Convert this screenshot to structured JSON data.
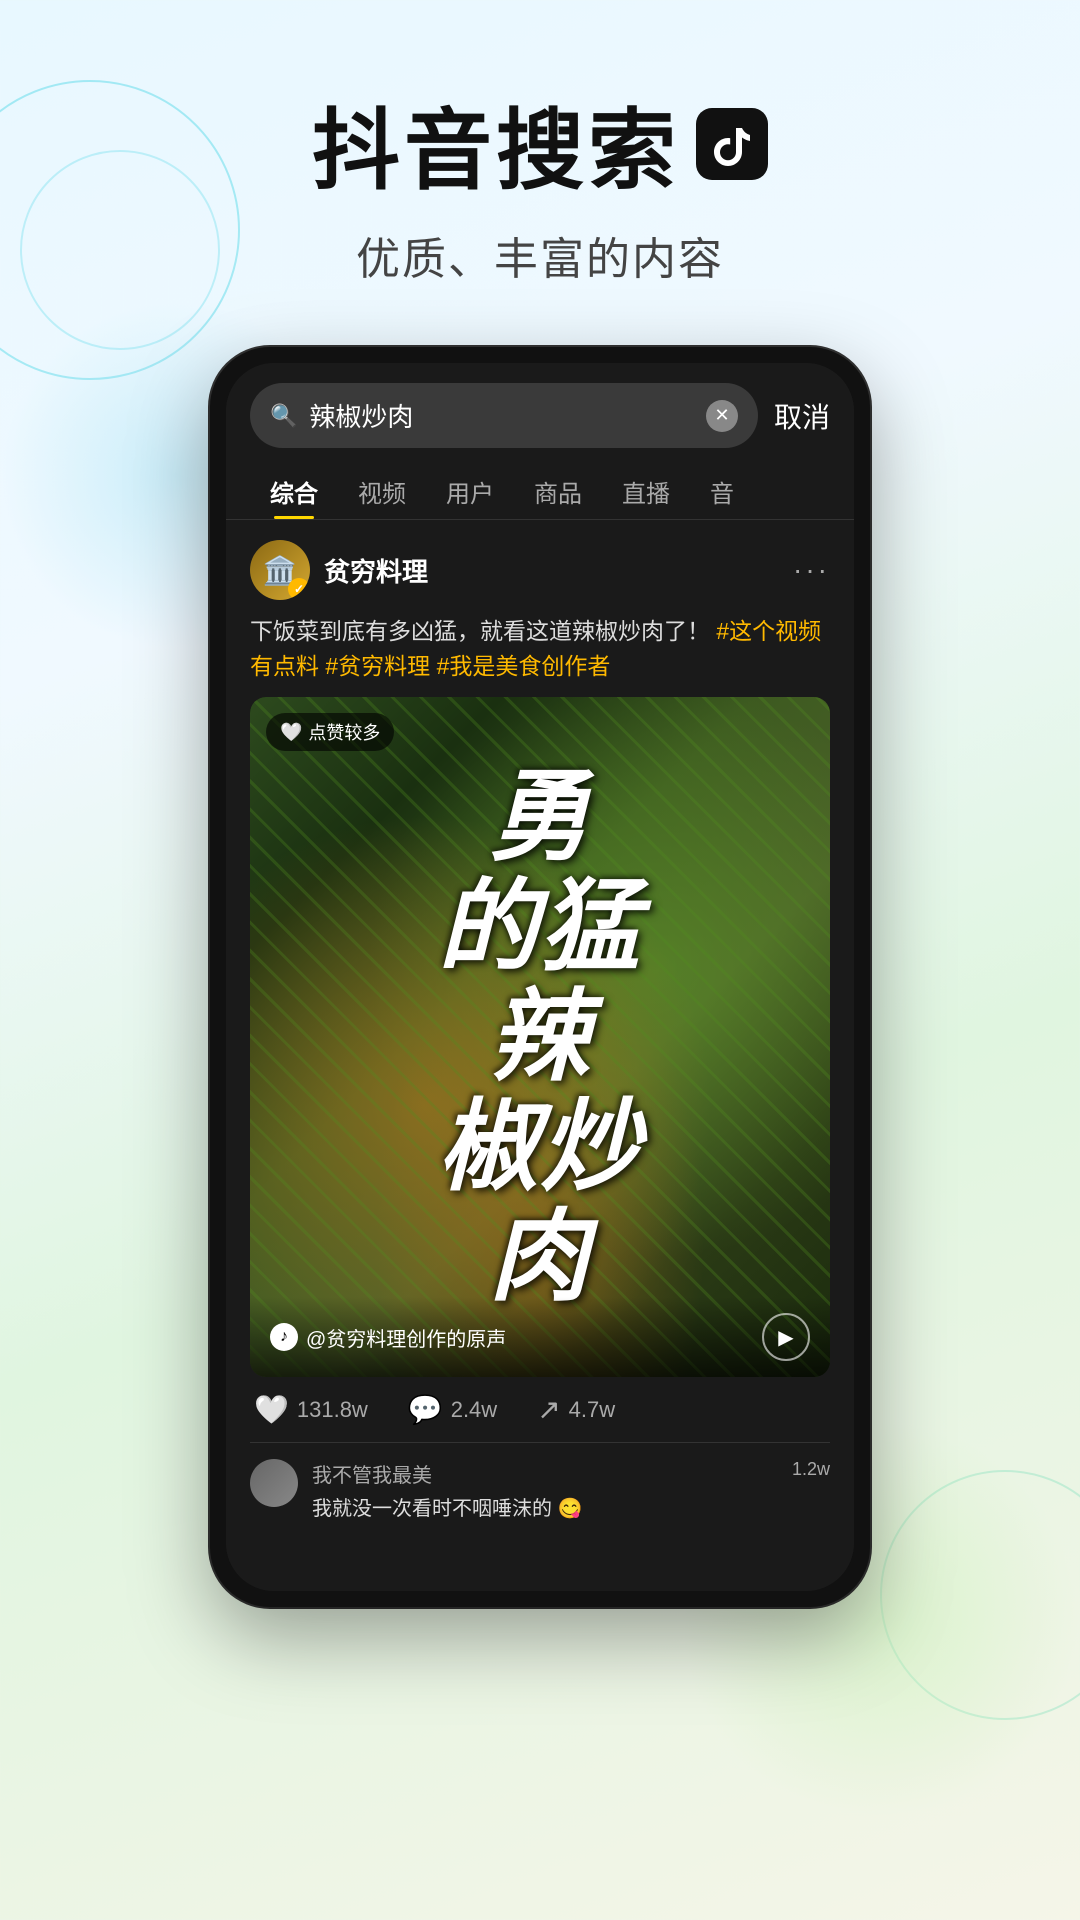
{
  "header": {
    "main_title": "抖音搜索",
    "subtitle": "优质、丰富的内容",
    "tiktok_icon": "♪"
  },
  "phone": {
    "search_bar": {
      "placeholder": "辣椒炒肉",
      "query": "辣椒炒肉",
      "cancel_label": "取消"
    },
    "tabs": [
      {
        "label": "综合",
        "active": true
      },
      {
        "label": "视频",
        "active": false
      },
      {
        "label": "用户",
        "active": false
      },
      {
        "label": "商品",
        "active": false
      },
      {
        "label": "直播",
        "active": false
      },
      {
        "label": "音",
        "active": false
      }
    ],
    "post": {
      "author_name": "贫穷料理",
      "author_emoji": "🏛️",
      "verified": "✓",
      "more_icon": "···",
      "description": "下饭菜到底有多凶猛，就看这道辣椒炒肉了！",
      "tags": "#这个视频有点料 #贫穷料理 #我是美食创作者",
      "hot_badge": "点赞较多",
      "video_big_text": "勇\n的猛\n辣\n椒炒\n肉",
      "video_source": "@贫穷料理创作的原声",
      "interactions": {
        "likes": "131.8w",
        "comments": "2.4w",
        "shares": "4.7w"
      },
      "comment": {
        "commenter_name": "我不管我最美",
        "comment_text": "我就没一次看时不咽唾沫的 😋",
        "likes": "1.2w"
      }
    }
  }
}
